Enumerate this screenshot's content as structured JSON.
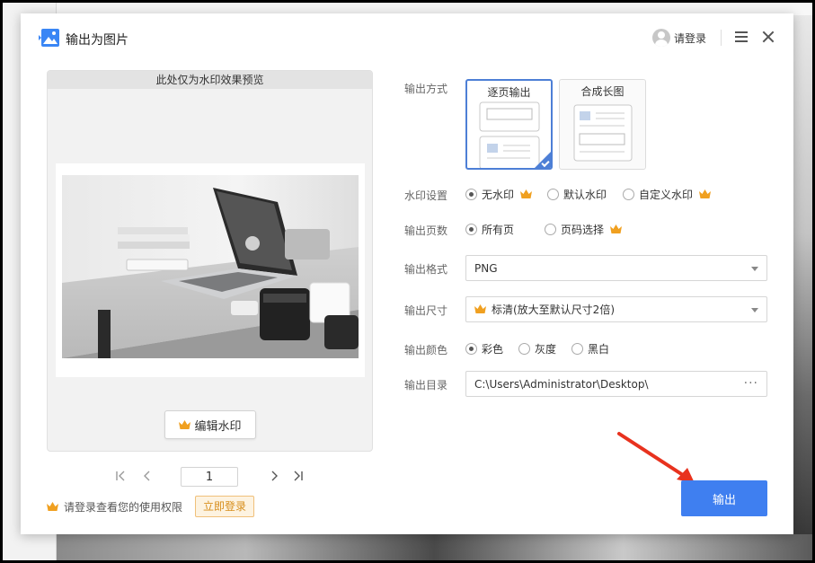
{
  "dialog": {
    "title": "输出为图片",
    "login_label": "请登录"
  },
  "preview": {
    "header": "此处仅为水印效果预览",
    "edit_watermark_label": "编辑水印"
  },
  "pager": {
    "page_value": "1"
  },
  "tip": {
    "text": "请登录查看您的使用权限",
    "login_now_label": "立即登录"
  },
  "form": {
    "output_mode": {
      "label": "输出方式",
      "options": [
        "逐页输出",
        "合成长图"
      ],
      "selected": "逐页输出"
    },
    "watermark": {
      "label": "水印设置",
      "options": [
        "无水印",
        "默认水印",
        "自定义水印"
      ],
      "selected": "无水印"
    },
    "pages": {
      "label": "输出页数",
      "options": [
        "所有页",
        "页码选择"
      ],
      "selected": "所有页"
    },
    "format": {
      "label": "输出格式",
      "value": "PNG"
    },
    "size": {
      "label": "输出尺寸",
      "value": "标清(放大至默认尺寸2倍)"
    },
    "color": {
      "label": "输出颜色",
      "options": [
        "彩色",
        "灰度",
        "黑白"
      ],
      "selected": "彩色"
    },
    "directory": {
      "label": "输出目录",
      "value": "C:\\Users\\Administrator\\Desktop\\",
      "more": "···"
    }
  },
  "export_label": "输出",
  "colors": {
    "accent": "#3f7ff0",
    "selected_border": "#4d7fd6",
    "crown": "#f0a020",
    "arrow": "#e8321e"
  },
  "icons": [
    "app-image-icon",
    "avatar-icon",
    "menu-icon",
    "close-icon",
    "crown-icon",
    "first-page-icon",
    "prev-page-icon",
    "next-page-icon",
    "last-page-icon",
    "more-icon",
    "check-icon"
  ]
}
